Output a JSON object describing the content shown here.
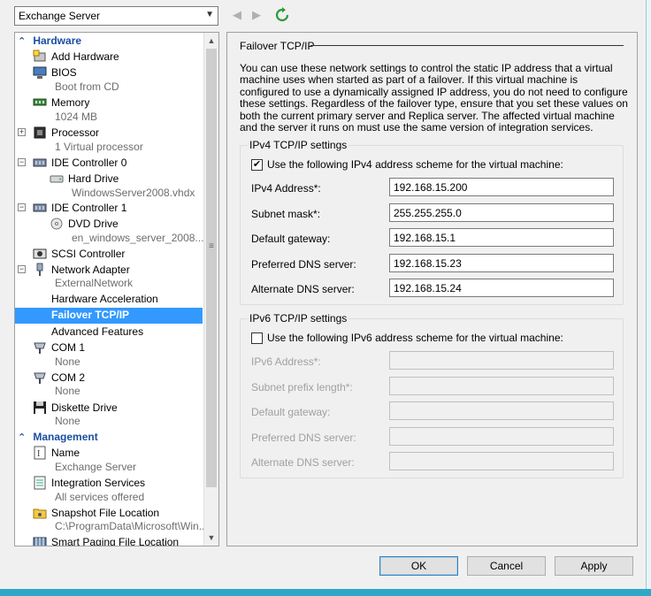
{
  "vm_selector": {
    "value": "Exchange Server"
  },
  "toolbar": {
    "back_icon": "back-arrow",
    "forward_icon": "forward-arrow",
    "refresh_icon": "refresh"
  },
  "tree": {
    "hardware_header": "Hardware",
    "management_header": "Management",
    "hardware": [
      {
        "id": "add-hardware",
        "label": "Add Hardware"
      },
      {
        "id": "bios",
        "label": "BIOS",
        "sub": "Boot from CD"
      },
      {
        "id": "memory",
        "label": "Memory",
        "sub": "1024 MB"
      },
      {
        "id": "processor",
        "label": "Processor",
        "sub": "1 Virtual processor"
      },
      {
        "id": "ide-controller-0",
        "label": "IDE Controller 0"
      },
      {
        "id": "hard-drive",
        "label": "Hard Drive",
        "sub": "WindowsServer2008.vhdx"
      },
      {
        "id": "ide-controller-1",
        "label": "IDE Controller 1"
      },
      {
        "id": "dvd-drive",
        "label": "DVD Drive",
        "sub": "en_windows_server_2008..."
      },
      {
        "id": "scsi-controller",
        "label": "SCSI Controller"
      },
      {
        "id": "network-adapter",
        "label": "Network Adapter",
        "sub": "ExternalNetwork"
      },
      {
        "id": "hardware-acceleration",
        "label": "Hardware Acceleration"
      },
      {
        "id": "failover-tcpip",
        "label": "Failover TCP/IP"
      },
      {
        "id": "advanced-features",
        "label": "Advanced Features"
      },
      {
        "id": "com1",
        "label": "COM 1",
        "sub": "None"
      },
      {
        "id": "com2",
        "label": "COM 2",
        "sub": "None"
      },
      {
        "id": "diskette-drive",
        "label": "Diskette Drive",
        "sub": "None"
      }
    ],
    "management": [
      {
        "id": "name",
        "label": "Name",
        "sub": "Exchange Server"
      },
      {
        "id": "integration-services",
        "label": "Integration Services",
        "sub": "All services offered"
      },
      {
        "id": "snapshot-file-location",
        "label": "Snapshot File Location",
        "sub": "C:\\ProgramData\\Microsoft\\Win..."
      },
      {
        "id": "smart-paging",
        "label": "Smart Paging File Location"
      }
    ]
  },
  "panel": {
    "title": "Failover TCP/IP",
    "description": "You can use these network settings to control the static IP address that a virtual machine uses when started as part of a failover. If this virtual machine is configured to use a dynamically assigned IP address, you do not need to configure these settings. Regardless of the failover type, ensure that you set these values on both the current primary server and Replica server. The affected virtual machine and the server it runs on must use the same version of integration services.",
    "ipv4": {
      "group_title": "IPv4 TCP/IP settings",
      "checkbox_label": "Use the following IPv4 address scheme for the virtual machine:",
      "checked": true,
      "fields": [
        {
          "label": "IPv4 Address*:",
          "value": "192.168.15.200"
        },
        {
          "label": "Subnet mask*:",
          "value": "255.255.255.0"
        },
        {
          "label": "Default gateway:",
          "value": "192.168.15.1"
        },
        {
          "label": "Preferred DNS server:",
          "value": "192.168.15.23"
        },
        {
          "label": "Alternate DNS server:",
          "value": "192.168.15.24"
        }
      ]
    },
    "ipv6": {
      "group_title": "IPv6 TCP/IP settings",
      "checkbox_label": "Use the following IPv6 address scheme for the virtual machine:",
      "checked": false,
      "fields": [
        {
          "label": "IPv6 Address*:",
          "value": ""
        },
        {
          "label": "Subnet prefix length*:",
          "value": ""
        },
        {
          "label": "Default gateway:",
          "value": ""
        },
        {
          "label": "Preferred DNS server:",
          "value": ""
        },
        {
          "label": "Alternate DNS server:",
          "value": ""
        }
      ]
    }
  },
  "buttons": {
    "ok": "OK",
    "cancel": "Cancel",
    "apply": "Apply"
  },
  "colors": {
    "accent": "#1a4fa0",
    "selection": "#3399ff",
    "frame": "#2fa8c8"
  }
}
